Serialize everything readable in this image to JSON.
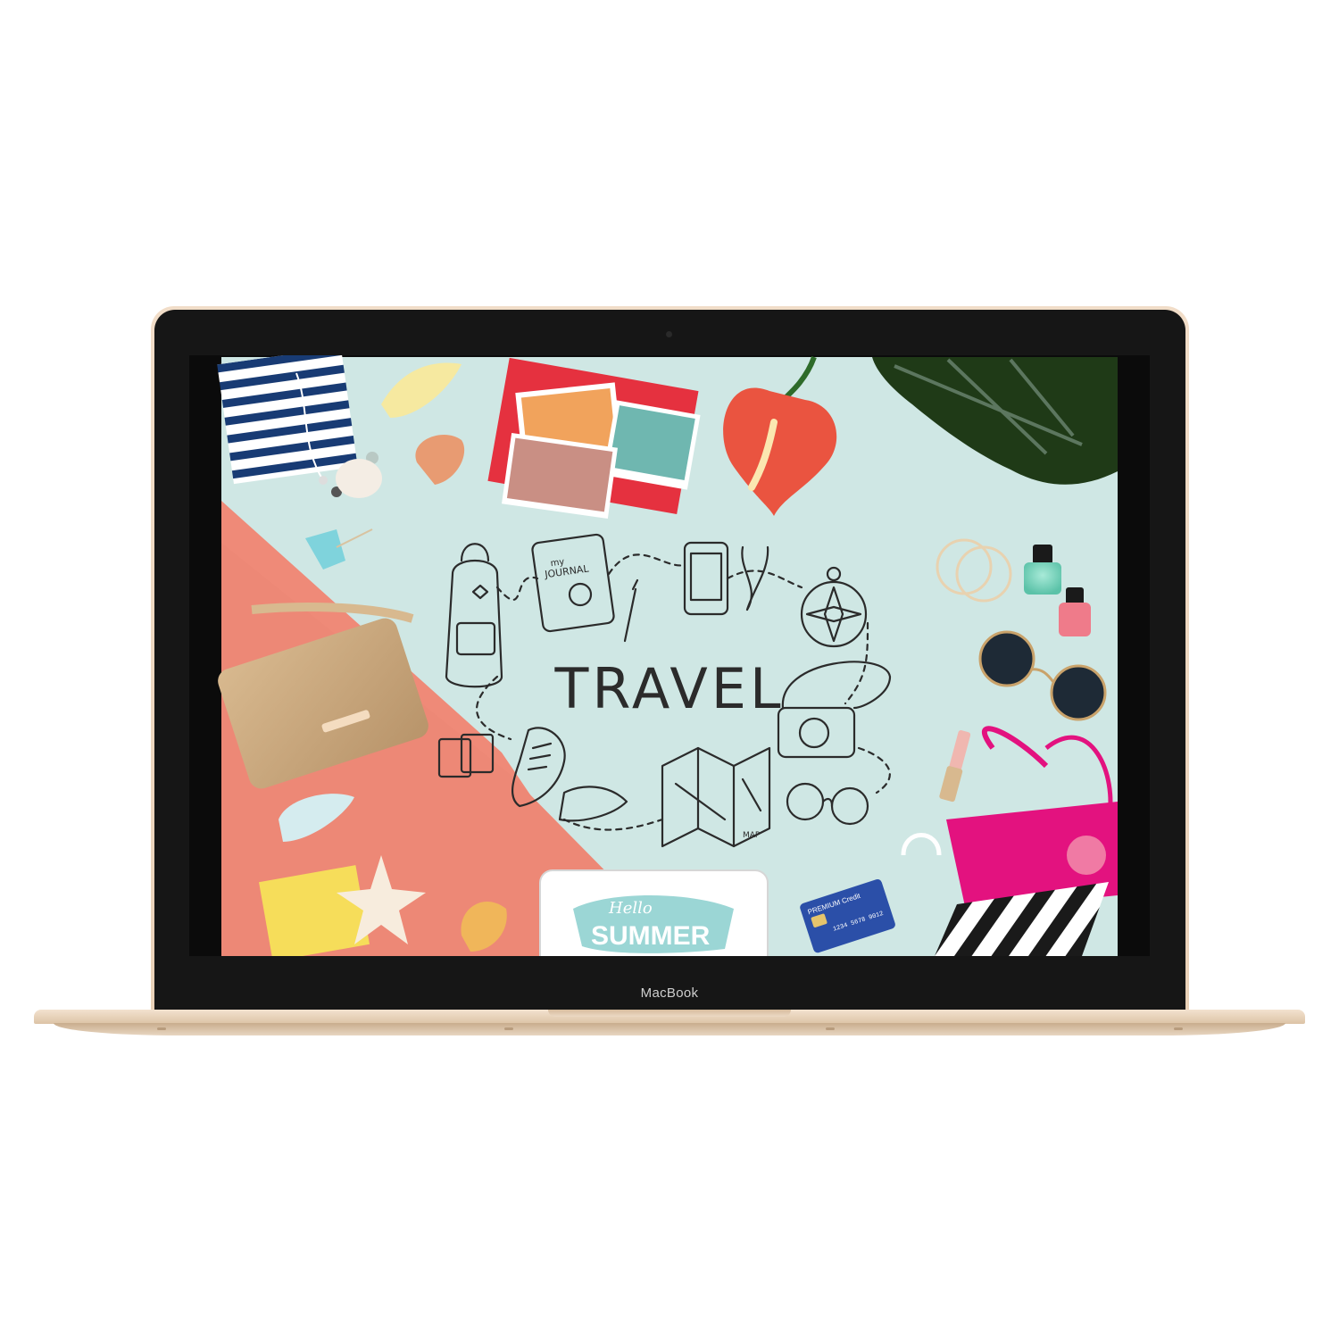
{
  "device": {
    "brand_label": "MacBook"
  },
  "screen": {
    "headline": "TRAVEL",
    "journal_small": "my",
    "journal_label": "JOURNAL",
    "map_label": "MAP",
    "tablet_hello": "Hello",
    "tablet_summer": "SUMMER",
    "card_title": "PREMIUM Credit",
    "card_number": "1234  5678  9012"
  },
  "colors": {
    "mint": "#cfe7e4",
    "coral": "#ee8b78",
    "gold": "#e9d3bb",
    "pink": "#e3127f",
    "red": "#e5313f"
  }
}
